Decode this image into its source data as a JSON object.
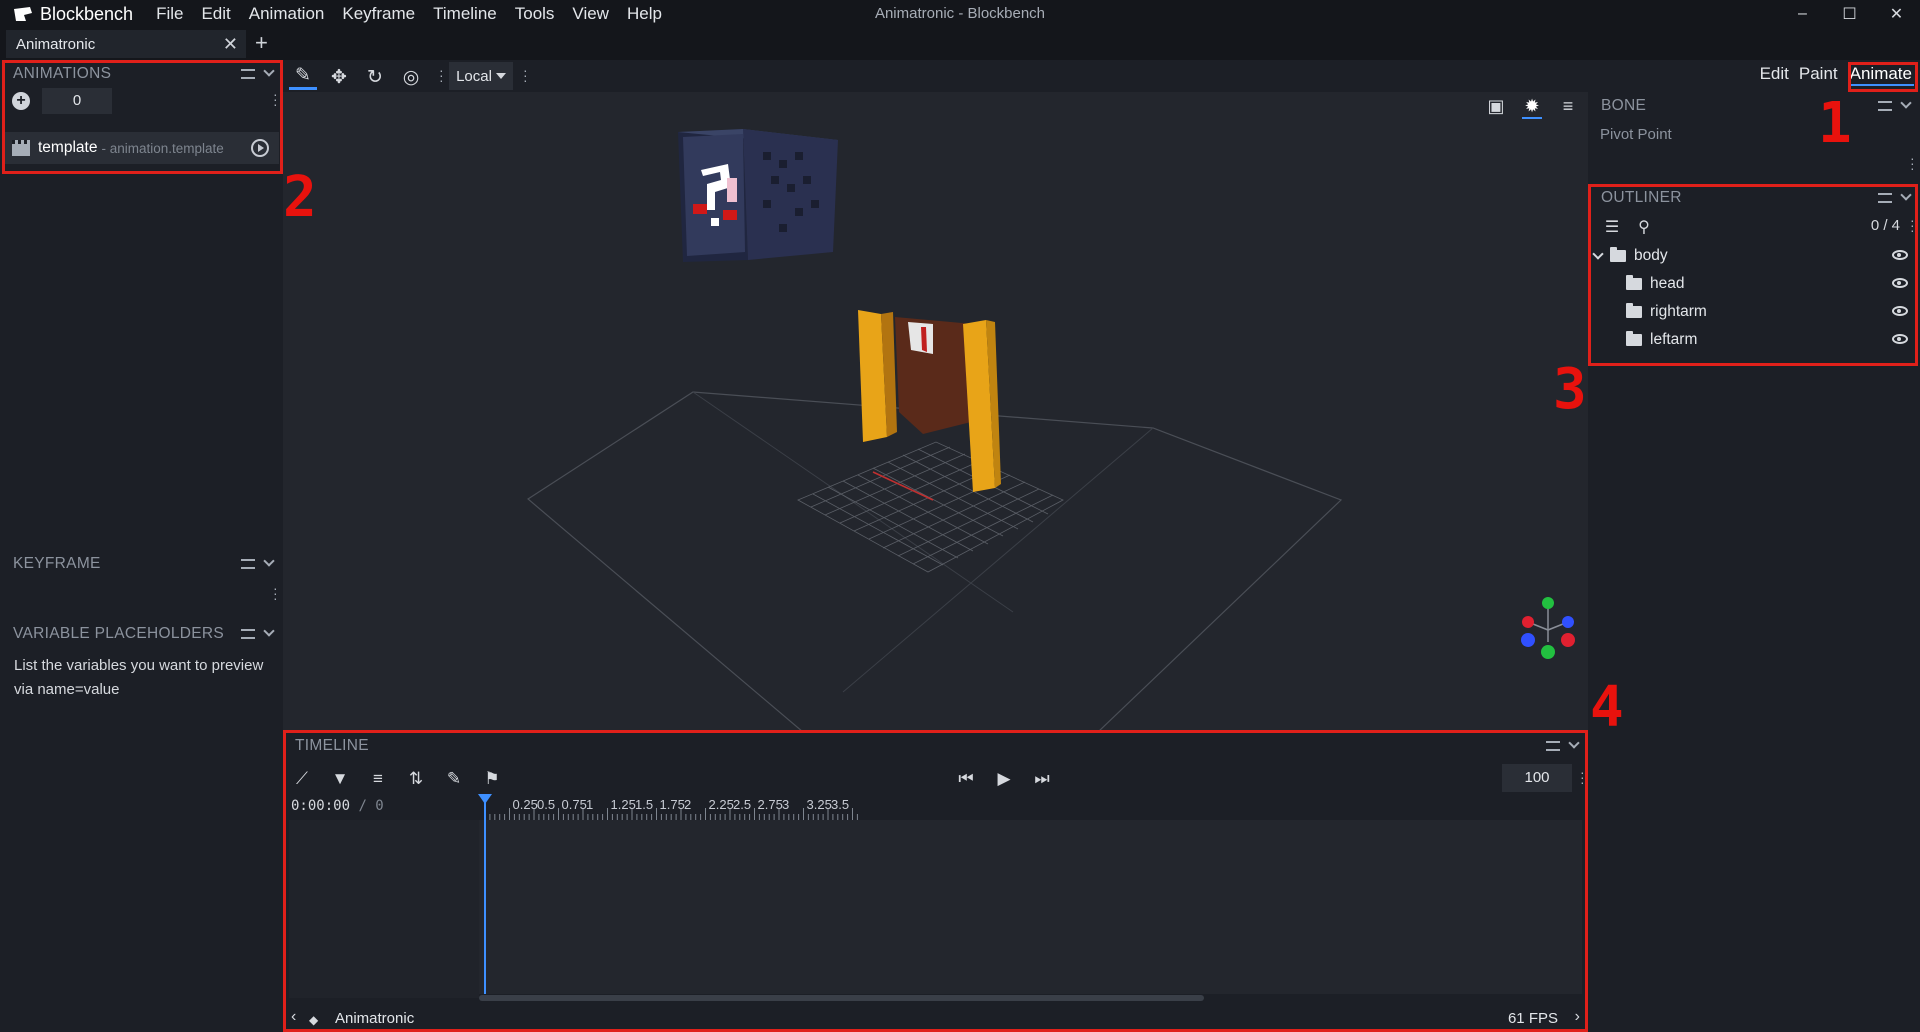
{
  "app": {
    "name": "Blockbench",
    "window_title": "Animatronic - Blockbench",
    "menu": [
      "File",
      "Edit",
      "Animation",
      "Keyframe",
      "Timeline",
      "Tools",
      "View",
      "Help"
    ],
    "window_controls": [
      "–",
      "☐",
      "✕"
    ]
  },
  "tabs": [
    {
      "label": "Animatronic",
      "close": "✕"
    }
  ],
  "tab_add": "+",
  "toolbar": {
    "space": "Local",
    "modes": [
      "Edit",
      "Paint",
      "Animate"
    ],
    "active_mode": "Animate"
  },
  "animations_panel": {
    "title": "ANIMATIONS",
    "counter": "0",
    "items": [
      {
        "name": "template",
        "subtitle": "- animation.template"
      }
    ]
  },
  "keyframe_panel": {
    "title": "KEYFRAME"
  },
  "variables_panel": {
    "title": "VARIABLE PLACEHOLDERS",
    "text": "List the variables you want to preview via name=value"
  },
  "bone_panel": {
    "title": "BONE",
    "label": "Pivot Point"
  },
  "outliner": {
    "title": "OUTLINER",
    "count": "0 / 4",
    "items": [
      {
        "name": "body",
        "level": 0,
        "expanded": true
      },
      {
        "name": "head",
        "level": 1
      },
      {
        "name": "rightarm",
        "level": 1
      },
      {
        "name": "leftarm",
        "level": 1
      }
    ]
  },
  "timeline": {
    "title": "TIMELINE",
    "zoom": "100",
    "time": "0:00:00",
    "time_sep": "/ 0",
    "ruler_ticks": [
      "0.25",
      "0.5",
      "0.75",
      "1",
      "1.25",
      "1.5",
      "1.75",
      "2",
      "2.25",
      "2.5",
      "2.75",
      "3",
      "3.25",
      "3.5"
    ],
    "footer_name": "Animatronic",
    "fps": "61 FPS"
  },
  "annotations": [
    "1",
    "2",
    "3",
    "4"
  ],
  "colors": {
    "accent": "#3e90ff",
    "annotation": "#e0201a",
    "axis_x": "#e02030",
    "axis_y": "#22c040",
    "axis_z": "#3050ff"
  }
}
